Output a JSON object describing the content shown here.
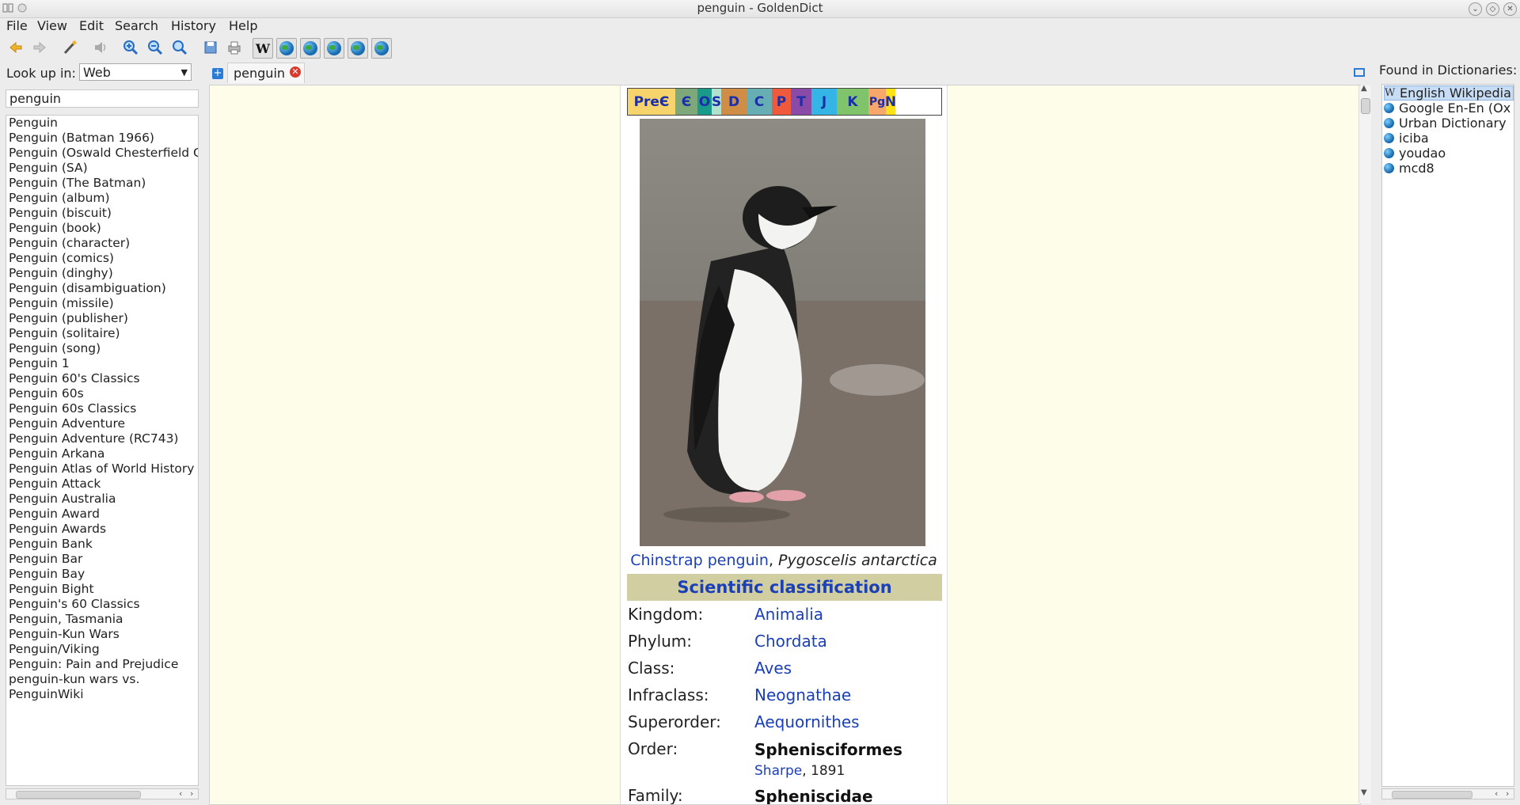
{
  "window": {
    "title": "penguin - GoldenDict"
  },
  "menu": [
    "File",
    "View",
    "Edit",
    "Search",
    "History",
    "Help"
  ],
  "toolbar": {
    "icons": [
      "back-arrow-icon",
      "forward-arrow-icon",
      "wand-icon",
      "speaker-icon",
      "zoom-in-icon",
      "zoom-out-icon",
      "zoom-reset-icon",
      "save-icon",
      "print-icon",
      "wikipedia-icon",
      "globe-icon",
      "globe-icon",
      "globe-icon",
      "globe-icon",
      "globe-icon"
    ],
    "wiki_letter": "W"
  },
  "sidebar": {
    "lookup_label": "Look up in:",
    "lookup_selected": "Web",
    "search_value": "penguin",
    "words": [
      "Penguin",
      "Penguin (Batman 1966)",
      "Penguin (Oswald Chesterfield C",
      "Penguin (SA)",
      "Penguin (The Batman)",
      "Penguin (album)",
      "Penguin (biscuit)",
      "Penguin (book)",
      "Penguin (character)",
      "Penguin (comics)",
      "Penguin (dinghy)",
      "Penguin (disambiguation)",
      "Penguin (missile)",
      "Penguin (publisher)",
      "Penguin (solitaire)",
      "Penguin (song)",
      "Penguin 1",
      "Penguin 60's Classics",
      "Penguin 60s",
      "Penguin 60s Classics",
      "Penguin Adventure",
      "Penguin Adventure (RC743)",
      "Penguin Arkana",
      "Penguin Atlas of World History",
      "Penguin Attack",
      "Penguin Australia",
      "Penguin Award",
      "Penguin Awards",
      "Penguin Bank",
      "Penguin Bar",
      "Penguin Bay",
      "Penguin Bight",
      "Penguin's 60 Classics",
      "Penguin, Tasmania",
      "Penguin-Kun Wars",
      "Penguin/Viking",
      "Penguin: Pain and Prejudice",
      "penguin-kun wars vs.",
      "PenguinWiki"
    ]
  },
  "tabs": [
    {
      "label": "penguin"
    }
  ],
  "article": {
    "timeline": [
      {
        "label": "PreЄ",
        "color": "#f7d46b"
      },
      {
        "label": "Є",
        "color": "#7fa87a"
      },
      {
        "label": "O",
        "color": "#1a9a8a"
      },
      {
        "label": "S",
        "color": "#b3e1d0"
      },
      {
        "label": "D",
        "color": "#cf8d45"
      },
      {
        "label": "C",
        "color": "#67aeb4"
      },
      {
        "label": "P",
        "color": "#ef5a3c"
      },
      {
        "label": "T",
        "color": "#8a4aa8"
      },
      {
        "label": "J",
        "color": "#35b5e5"
      },
      {
        "label": "K",
        "color": "#7fc36a"
      },
      {
        "label": "Pg",
        "color": "#f7a76a"
      },
      {
        "label": "N",
        "color": "#ffe11a"
      }
    ],
    "caption_link": "Chinstrap penguin",
    "caption_sep": ", ",
    "caption_species": "Pygoscelis antarctica",
    "sci_class_header": "Scientific classification",
    "taxonomy": [
      {
        "rank": "Kingdom:",
        "value": "Animalia",
        "link": true
      },
      {
        "rank": "Phylum:",
        "value": "Chordata",
        "link": true
      },
      {
        "rank": "Class:",
        "value": "Aves",
        "link": true
      },
      {
        "rank": "Infraclass:",
        "value": "Neognathae",
        "link": true
      },
      {
        "rank": "Superorder:",
        "value": "Aequornithes",
        "link": true
      },
      {
        "rank": "Order:",
        "value": "Sphenisciformes",
        "link": false
      },
      {
        "rank": "Family:",
        "value": "Spheniscidae",
        "link": false
      }
    ],
    "order_author": "Sharpe",
    "order_year": ", 1891"
  },
  "dictionaries": {
    "label": "Found in Dictionaries:",
    "items": [
      "English Wikipedia",
      "Google En-En (Ox",
      "Urban Dictionary",
      "iciba",
      "youdao",
      "mcd8"
    ]
  }
}
